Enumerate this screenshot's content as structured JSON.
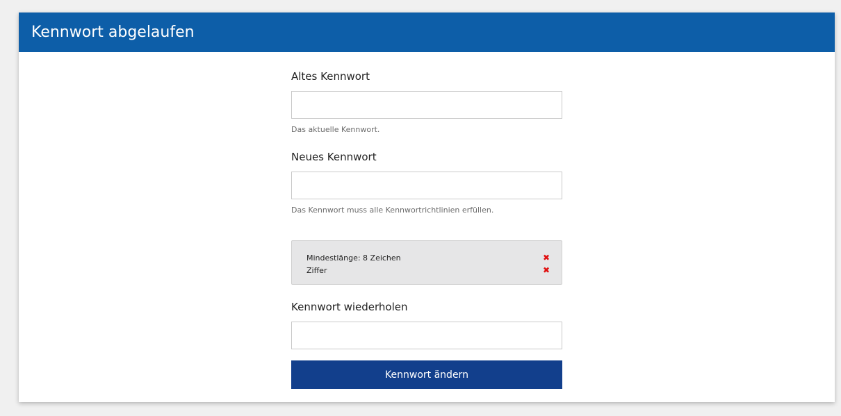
{
  "header": {
    "title": "Kennwort abgelaufen"
  },
  "form": {
    "old_password": {
      "label": "Altes Kennwort",
      "value": "",
      "help": "Das aktuelle Kennwort."
    },
    "new_password": {
      "label": "Neues Kennwort",
      "value": "",
      "help": "Das Kennwort muss alle Kennwortrichtlinien erfüllen."
    },
    "rules": [
      {
        "label": "Mindestlänge: 8 Zeichen",
        "status": "failed",
        "icon": "cross-icon"
      },
      {
        "label": "Ziffer",
        "status": "failed",
        "icon": "cross-icon"
      }
    ],
    "repeat_password": {
      "label": "Kennwort wiederholen",
      "value": ""
    },
    "submit_label": "Kennwort ändern"
  },
  "colors": {
    "header_bg": "#0d5ea8",
    "button_bg": "#123f8c",
    "rule_fail": "#e01010",
    "rules_box_bg": "#e6e6e7"
  }
}
